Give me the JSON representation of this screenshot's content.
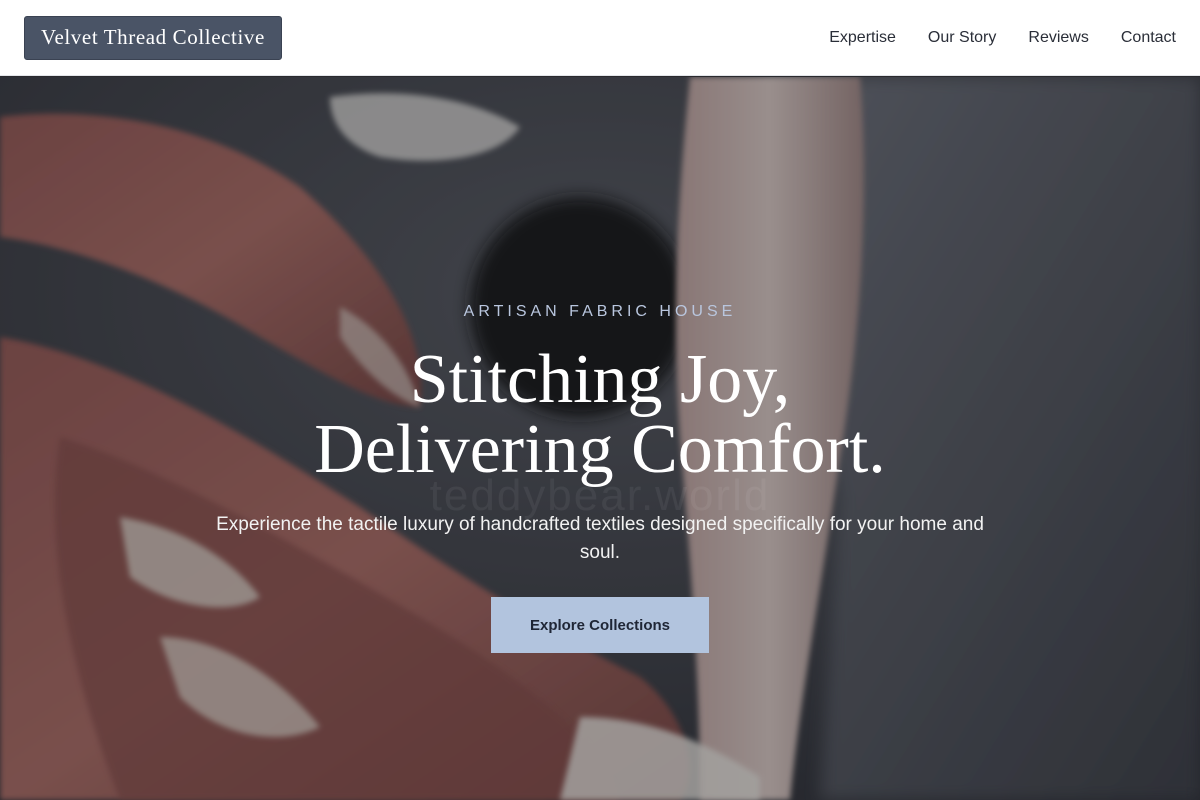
{
  "header": {
    "logo_text": "Velvet Thread Collective",
    "nav": [
      {
        "label": "Expertise"
      },
      {
        "label": "Our Story"
      },
      {
        "label": "Reviews"
      },
      {
        "label": "Contact"
      }
    ]
  },
  "hero": {
    "eyebrow": "ARTISAN FABRIC HOUSE",
    "headline_line1": "Stitching Joy,",
    "headline_line2": "Delivering Comfort.",
    "subtitle": "Experience the tactile luxury of handcrafted textiles designed specifically for your home and soul.",
    "cta_label": "Explore Collections",
    "watermark": "teddybear.world"
  },
  "colors": {
    "logo_bg": "#4a5466",
    "eyebrow": "#b9c6de",
    "cta_bg": "#b2c4de",
    "cta_text": "#1f2636"
  }
}
